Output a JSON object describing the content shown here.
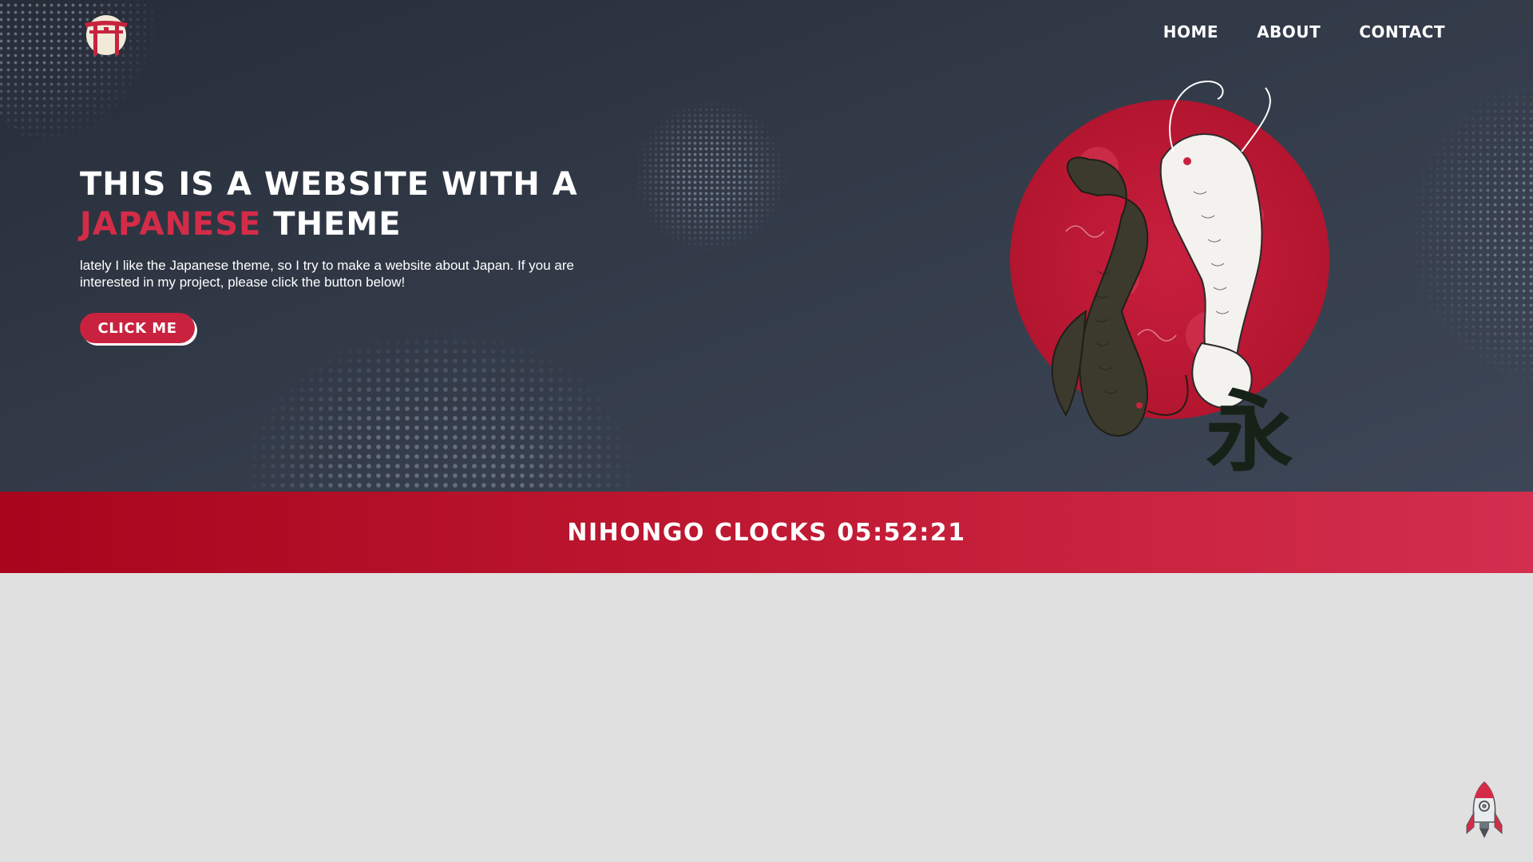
{
  "nav": {
    "items": [
      {
        "label": "HOME"
      },
      {
        "label": "ABOUT"
      },
      {
        "label": "CONTACT"
      }
    ]
  },
  "hero": {
    "headline_line1": "THIS IS A WEBSITE WITH A",
    "headline_accent": "JAPANESE",
    "headline_rest": " THEME",
    "description": "lately I like the Japanese theme, so I try to make a website about Japan. If you are interested in my project, please click the button below!",
    "cta_label": "CLICK ME",
    "kanji": "永"
  },
  "clock": {
    "label": "NIHONGO CLOCKS",
    "time": "05:52:21"
  },
  "colors": {
    "hero_bg": "#323a48",
    "accent_red": "#d42c48",
    "band_red": "#c21b35",
    "page_bg": "#e0e0e0"
  },
  "icons": {
    "logo": "torii-gate-icon",
    "back_to_top": "rocket-icon"
  }
}
